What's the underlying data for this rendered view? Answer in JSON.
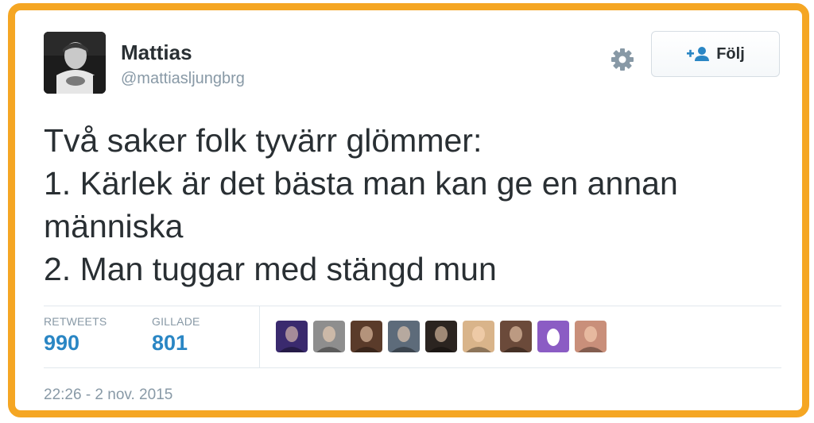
{
  "tweet": {
    "author": {
      "name": "Mattias",
      "handle": "@mattiasljungbrg",
      "avatar": "profile-photo"
    },
    "follow_button": {
      "label": "Följ",
      "icon": "add-person-icon"
    },
    "settings_icon": "gear-icon",
    "text_lines": [
      "Två saker folk tyvärr glömmer:",
      "1. Kärlek är det bästa man kan ge en annan",
      "människa",
      "2. Man tuggar med stängd mun"
    ],
    "stats": {
      "retweets_label": "RETWEETS",
      "retweets_value": "990",
      "likes_label": "GILLADE",
      "likes_value": "801"
    },
    "likers": [
      {
        "name": "liker-avatar-1",
        "kind": "photo",
        "color": "#3a2a6e"
      },
      {
        "name": "liker-avatar-2",
        "kind": "photo",
        "color": "#8e8e8e"
      },
      {
        "name": "liker-avatar-3",
        "kind": "photo",
        "color": "#5a3b2a"
      },
      {
        "name": "liker-avatar-4",
        "kind": "photo",
        "color": "#5d6b7a"
      },
      {
        "name": "liker-avatar-5",
        "kind": "photo",
        "color": "#2b2420"
      },
      {
        "name": "liker-avatar-6",
        "kind": "photo",
        "color": "#d9b48a"
      },
      {
        "name": "liker-avatar-7",
        "kind": "photo",
        "color": "#6b4a3a"
      },
      {
        "name": "liker-avatar-8",
        "kind": "egg",
        "color": "#8b5cc4"
      },
      {
        "name": "liker-avatar-9",
        "kind": "photo",
        "color": "#c98f7a"
      }
    ],
    "timestamp": "22:26 - 2 nov. 2015"
  },
  "colors": {
    "frame_border": "#f5a623",
    "text": "#292f33",
    "muted": "#8899a6",
    "stat_value": "#2a86c4",
    "follow_icon": "#2a86c4",
    "divider": "#e1e8ed"
  }
}
